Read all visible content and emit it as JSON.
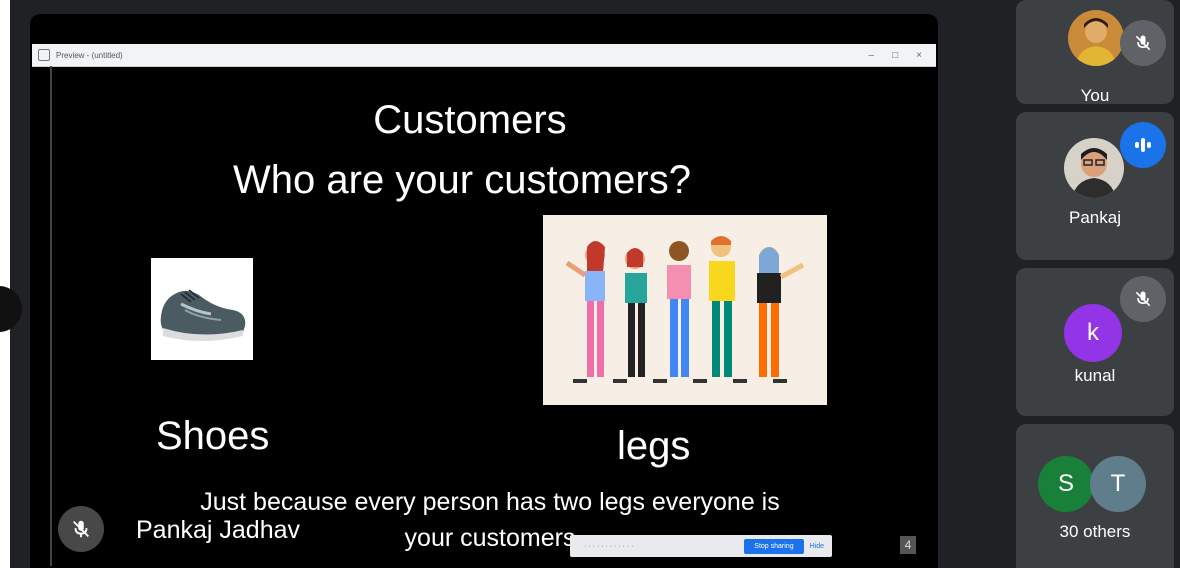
{
  "window": {
    "title": "Preview - (untitled)"
  },
  "slide": {
    "title": "Customers",
    "question": "Who are  your customers?",
    "left_caption": "Shoes",
    "right_caption": "legs",
    "body_line1": "Just because every person has two legs everyone is",
    "body_line2": "your customers",
    "page_number": "4"
  },
  "presenter": {
    "name": "Pankaj Jadhav"
  },
  "share_notice": {
    "stop_label": "Stop sharing",
    "hide_label": "Hide"
  },
  "participants": [
    {
      "name": "You",
      "muted": true
    },
    {
      "name": "Pankaj",
      "speaking": true
    },
    {
      "name": "kunal",
      "initial": "k",
      "muted": true,
      "color": "#9334e6"
    },
    {
      "name": "30 others",
      "initials": [
        "S",
        "T"
      ],
      "colors": [
        "#188038",
        "#607d8b"
      ]
    }
  ]
}
